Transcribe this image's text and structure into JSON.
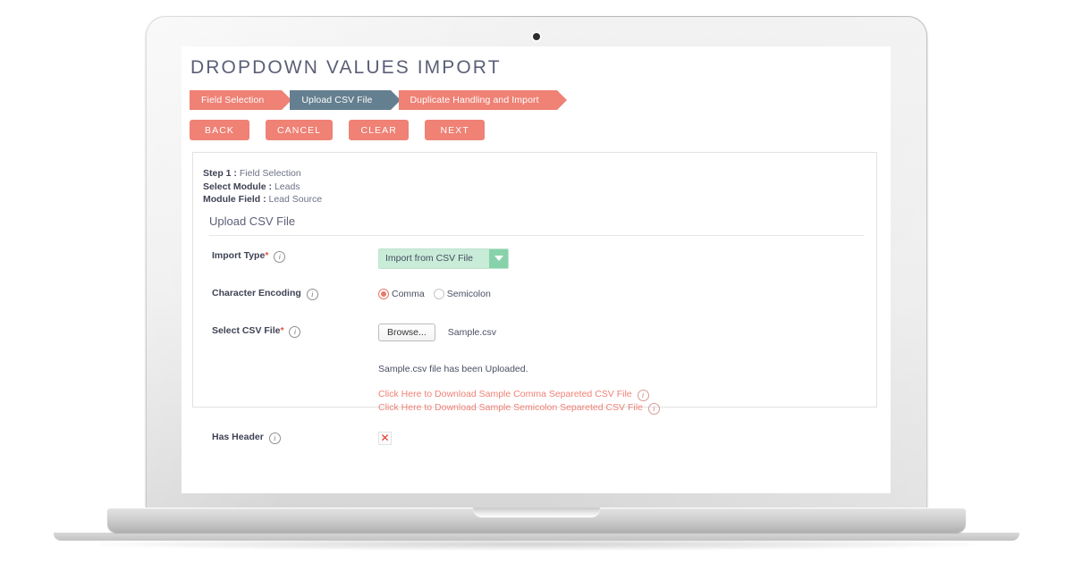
{
  "page": {
    "title": "DROPDOWN VALUES IMPORT"
  },
  "steps": [
    {
      "label": "Field Selection",
      "state": "done"
    },
    {
      "label": "Upload CSV File",
      "state": "active"
    },
    {
      "label": "Duplicate Handling and Import",
      "state": "pending"
    }
  ],
  "actions": {
    "back": "BACK",
    "cancel": "CANCEL",
    "clear": "CLEAR",
    "next": "NEXT"
  },
  "summary": {
    "step_label": "Step 1 :",
    "step_value": "Field Selection",
    "module_label": "Select Module :",
    "module_value": "Leads",
    "field_label": "Module Field :",
    "field_value": "Lead Source"
  },
  "section": {
    "heading": "Upload CSV File"
  },
  "form": {
    "import_type": {
      "label": "Import Type",
      "required": "*",
      "selected": "Import from CSV File",
      "options": [
        "Import from CSV File"
      ]
    },
    "character_encoding": {
      "label": "Character Encoding",
      "options": [
        {
          "label": "Comma",
          "selected": true
        },
        {
          "label": "Semicolon",
          "selected": false
        }
      ]
    },
    "select_csv_file": {
      "label": "Select CSV File",
      "required": "*",
      "browse_label": "Browse...",
      "file_name": "Sample.csv",
      "upload_note": "Sample.csv file has been Uploaded."
    },
    "download_links": [
      "Click Here to Download Sample Comma Separeted CSV File",
      "Click Here to Download Sample Semicolon Separeted CSV File"
    ],
    "has_header": {
      "label": "Has Header",
      "value": "✕",
      "checked": false
    },
    "info_icon_glyph": "i"
  },
  "colors": {
    "accent_salmon": "#ef8175",
    "step_active_slate": "#647f8f",
    "select_mint": "#c8ecd8",
    "select_arrow_green": "#88d2ab",
    "title_text": "#5b5f77",
    "error_red": "#e2382c"
  }
}
